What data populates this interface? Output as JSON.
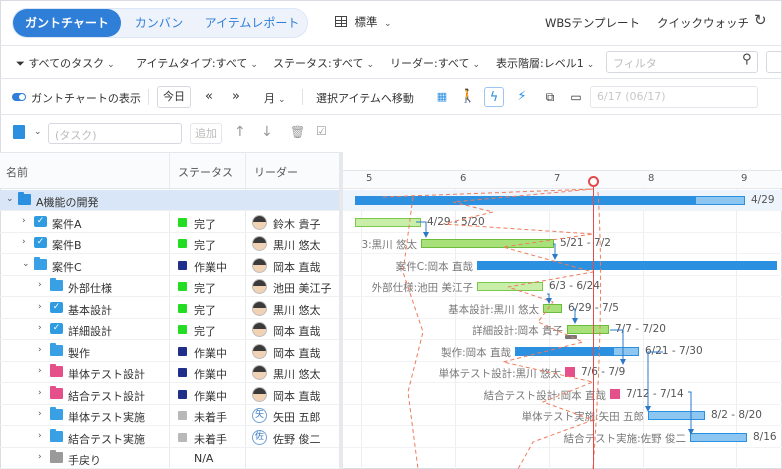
{
  "tabs": [
    {
      "label": "ガントチャート",
      "active": true
    },
    {
      "label": "カンバン",
      "active": false
    },
    {
      "label": "アイテムレポート",
      "active": false
    }
  ],
  "view_selector": {
    "label": "標準"
  },
  "top_links": {
    "wbs": "WBSテンプレート",
    "quick_watch": "クイックウォッチ"
  },
  "filters": {
    "all_tasks": "すべてのタスク",
    "item_type": "アイテムタイプ:すべて",
    "status": "ステータス:すべて",
    "leader": "リーダー:すべて",
    "display_level": "表示階層:レベル1",
    "filter_placeholder": "フィルタ"
  },
  "toolbar": {
    "show_gantt": "ガントチャートの表示",
    "today": "今日",
    "scale": "月",
    "goto_selected": "選択アイテムへ移動",
    "date_placeholder": "6/17 (06/17)"
  },
  "taskbar": {
    "task_placeholder": "(タスク)",
    "add_label": "追加"
  },
  "columns": {
    "name": "名前",
    "status": "ステータス",
    "leader": "リーダー"
  },
  "colors": {
    "accent": "#2f7ed8",
    "done": "#22dd22",
    "in_progress": "#1f2f8a",
    "not_started": "#b8b8b8",
    "today_line": "#e34b4b"
  },
  "tasks": [
    {
      "name": "A機能の開発",
      "indent": 0,
      "expand": "down",
      "icon": "cube-icon",
      "status": "",
      "leader": "",
      "selected": true
    },
    {
      "name": "案件A",
      "indent": 1,
      "expand": "right",
      "icon": "check-folder-icon",
      "status": "完了",
      "status_color": "#22dd22",
      "leader": "鈴木 貴子"
    },
    {
      "name": "案件B",
      "indent": 1,
      "expand": "right",
      "icon": "check-folder-icon",
      "status": "完了",
      "status_color": "#22dd22",
      "leader": "黒川 悠太"
    },
    {
      "name": "案件C",
      "indent": 1,
      "expand": "down",
      "icon": "folder-icon",
      "status": "作業中",
      "status_color": "#1f2f8a",
      "leader": "岡本 直哉"
    },
    {
      "name": "外部仕様",
      "indent": 2,
      "expand": "right",
      "icon": "folder-icon",
      "status": "完了",
      "status_color": "#22dd22",
      "leader": "池田 美江子"
    },
    {
      "name": "基本設計",
      "indent": 2,
      "expand": "right",
      "icon": "check-folder-icon",
      "status": "完了",
      "status_color": "#22dd22",
      "leader": "黒川 悠太"
    },
    {
      "name": "詳細設計",
      "indent": 2,
      "expand": "right",
      "icon": "check-folder-icon",
      "status": "完了",
      "status_color": "#22dd22",
      "leader": "岡本 直哉"
    },
    {
      "name": "製作",
      "indent": 2,
      "expand": "right",
      "icon": "folder-icon",
      "status": "作業中",
      "status_color": "#1f2f8a",
      "leader": "岡本 直哉"
    },
    {
      "name": "単体テスト設計",
      "indent": 2,
      "expand": "right",
      "icon": "pink-folder-icon",
      "status": "作業中",
      "status_color": "#1f2f8a",
      "leader": "黒川 悠太"
    },
    {
      "name": "結合テスト設計",
      "indent": 2,
      "expand": "right",
      "icon": "pink-folder-icon",
      "status": "作業中",
      "status_color": "#1f2f8a",
      "leader": "岡本 直哉"
    },
    {
      "name": "単体テスト実施",
      "indent": 2,
      "expand": "right",
      "icon": "folder-icon",
      "status": "未着手",
      "status_color": "#b8b8b8",
      "leader": "矢田 五郎",
      "avatar_initial": "矢"
    },
    {
      "name": "結合テスト実施",
      "indent": 2,
      "expand": "right",
      "icon": "folder-icon",
      "status": "未着手",
      "status_color": "#b8b8b8",
      "leader": "佐野 俊二",
      "avatar_initial": "佐"
    },
    {
      "name": "手戻り",
      "indent": 2,
      "expand": "right",
      "icon": "gray-folder-icon",
      "status": "N/A",
      "status_color": "",
      "leader": ""
    }
  ],
  "gantt": {
    "months": [
      "5",
      "6",
      "7",
      "8",
      "9"
    ],
    "bars": [
      {
        "row": 0,
        "label_right": "4/29"
      },
      {
        "row": 1,
        "label_right": "4/29 - 5/20"
      },
      {
        "row": 2,
        "label_left": "3:黒川 悠太",
        "label_right": "5/21 - 7/2"
      },
      {
        "row": 3,
        "label_left": "案件C:岡本 直哉",
        "label_right": "6/8 -"
      },
      {
        "row": 4,
        "label_left": "外部仕様:池田 美江子",
        "label_right": "6/3 - 6/24"
      },
      {
        "row": 5,
        "label_left": "基本設計:黒川 悠太",
        "label_right": "6/29 - 7/5"
      },
      {
        "row": 6,
        "label_left": "詳細設計:岡本 貴子",
        "label_right": "7/7 - 7/20"
      },
      {
        "row": 7,
        "label_left": "製作:岡本 直哉",
        "label_right": "6/21 - 7/30"
      },
      {
        "row": 8,
        "label_left": "単体テスト設計:黒川 悠太",
        "label_right": "7/6 - 7/9"
      },
      {
        "row": 9,
        "label_left": "結合テスト設計:岡本 直哉",
        "label_right": "7/12 - 7/14"
      },
      {
        "row": 10,
        "label_left": "単体テスト実施:矢田 五郎",
        "label_right": "8/2 - 8/20"
      },
      {
        "row": 11,
        "label_left": "結合テスト実施:佐野 俊二",
        "label_right": "8/16"
      }
    ]
  }
}
